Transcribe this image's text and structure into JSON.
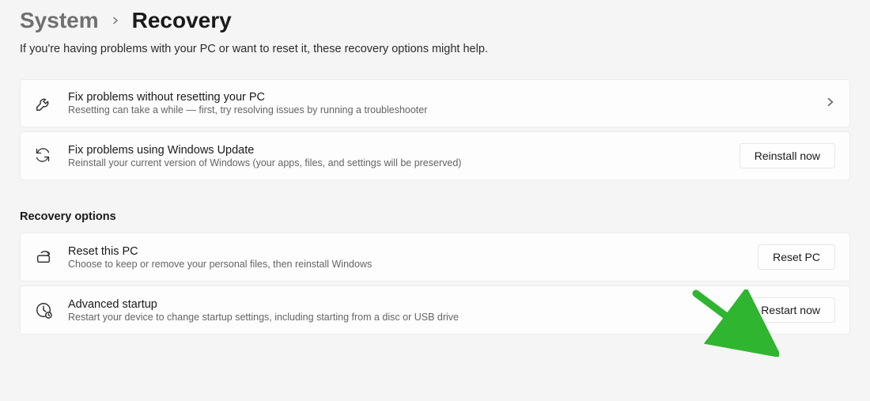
{
  "breadcrumb": {
    "parent": "System",
    "current": "Recovery"
  },
  "subtitle": "If you're having problems with your PC or want to reset it, these recovery options might help.",
  "cards": {
    "fix_no_reset": {
      "title": "Fix problems without resetting your PC",
      "desc": "Resetting can take a while — first, try resolving issues by running a troubleshooter"
    },
    "fix_update": {
      "title": "Fix problems using Windows Update",
      "desc": "Reinstall your current version of Windows (your apps, files, and settings will be preserved)",
      "button": "Reinstall now"
    },
    "recovery_section": "Recovery options",
    "reset_pc": {
      "title": "Reset this PC",
      "desc": "Choose to keep or remove your personal files, then reinstall Windows",
      "button": "Reset PC"
    },
    "advanced": {
      "title": "Advanced startup",
      "desc": "Restart your device to change startup settings, including starting from a disc or USB drive",
      "button": "Restart now"
    }
  }
}
